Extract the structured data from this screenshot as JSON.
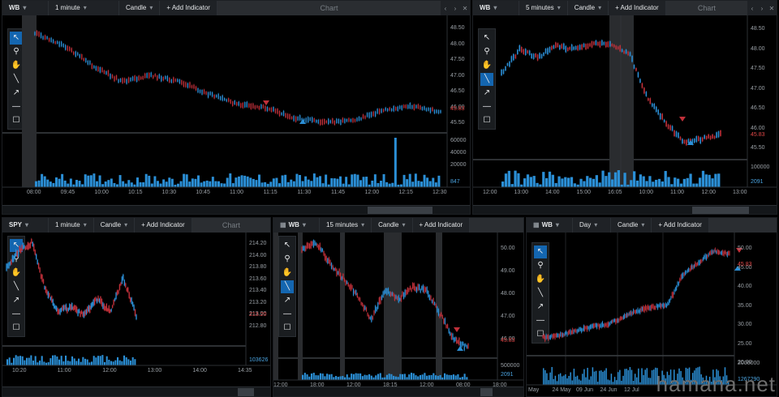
{
  "panels": [
    {
      "symbol": "WB",
      "interval": "1 minute",
      "type": "Candle",
      "add_indicator": "+ Add Indicator",
      "title": "Chart",
      "y_labels": [
        "48.50",
        "48.00",
        "47.50",
        "47.00",
        "46.50",
        "46.00",
        "45.50"
      ],
      "last_price": "45.83",
      "vol_labels": [
        "60000",
        "40000",
        "20000"
      ],
      "last_vol": "847",
      "x_labels": [
        "08:00",
        "09:45",
        "10:00",
        "10:15",
        "10:30",
        "10:45",
        "11:00",
        "11:15",
        "11:30",
        "11:45",
        "12:00",
        "12:15",
        "12:30"
      ]
    },
    {
      "symbol": "WB",
      "interval": "5 minutes",
      "type": "Candle",
      "add_indicator": "+ Add Indicator",
      "title": "Chart",
      "y_labels": [
        "48.50",
        "48.00",
        "47.50",
        "47.00",
        "46.50",
        "46.00",
        "45.50"
      ],
      "last_price": "45.83",
      "vol_labels": [
        "100000"
      ],
      "last_vol": "2091",
      "x_labels": [
        "12:00",
        "13:00",
        "14:00",
        "15:00",
        "16:05",
        "10:00",
        "11:00",
        "12:00",
        "13:00"
      ]
    },
    {
      "symbol": "SPY",
      "interval": "1 minute",
      "type": "Candle",
      "add_indicator": "+ Add Indicator",
      "title": "Chart",
      "y_labels": [
        "214.20",
        "214.00",
        "213.80",
        "213.60",
        "213.40",
        "213.20",
        "213.00",
        "212.80"
      ],
      "last_price": "213.20",
      "last_vol": "103626",
      "x_labels": [
        "10:20",
        "11:00",
        "12:00",
        "13:00",
        "14:00",
        "14:35"
      ]
    },
    {
      "symbol": "WB",
      "interval": "15 minutes",
      "type": "Candle",
      "add_indicator": "+ Add Indicator",
      "title": "",
      "y_labels": [
        "50.00",
        "49.00",
        "48.00",
        "47.00",
        "46.00"
      ],
      "last_price": "45.83",
      "vol_labels": [
        "500000"
      ],
      "last_vol": "2091",
      "x_labels": [
        "12:00",
        "18:00",
        "12:00",
        "18:15",
        "12:00",
        "08:00",
        "18:00"
      ]
    },
    {
      "symbol": "WB",
      "interval": "Day",
      "type": "Candle",
      "add_indicator": "+ Add Indicator",
      "title": "",
      "y_labels": [
        "50.00",
        "45.00",
        "40.00",
        "35.00",
        "30.00",
        "25.00",
        "20.00"
      ],
      "last_price": "45.83",
      "vol_labels": [
        "2000000"
      ],
      "last_vol": "1267290",
      "x_labels": [
        "May",
        "24 May",
        "09 Jun",
        "24 Jun",
        "12 Jul"
      ]
    }
  ],
  "tools": [
    "pointer-icon",
    "zoom-icon",
    "pan-hand-icon",
    "line-icon",
    "arrow-icon",
    "horizontal-line-icon",
    "rectangle-icon"
  ],
  "tool_glyphs": [
    "↖",
    "⚲",
    "✋",
    "╲",
    "↗",
    "—",
    "☐"
  ],
  "watermark": "hamana.net",
  "colors": {
    "up": "#2b8fd6",
    "down": "#c0303a",
    "volume": "#2b8fd6",
    "accent": "#1466b0"
  }
}
